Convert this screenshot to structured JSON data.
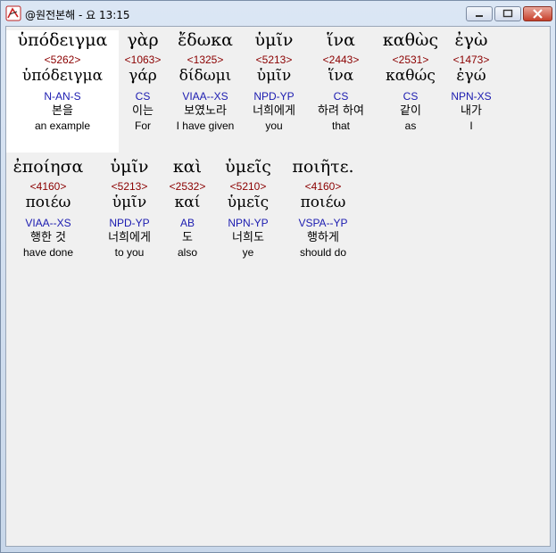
{
  "window": {
    "title": "@원전본해 - 요 13:15"
  },
  "lines": [
    {
      "words": [
        {
          "greek": "ὑπόδειγμα",
          "strong": "<5262>",
          "lemma": "ὑπόδειγμα",
          "morph": "N-AN-S",
          "korean": "본을",
          "english": "an example",
          "selected": true
        },
        {
          "greek": "γὰρ",
          "strong": "<1063>",
          "lemma": "γάρ",
          "morph": "CS",
          "korean": "이는",
          "english": "For"
        },
        {
          "greek": "ἔδωκα",
          "strong": "<1325>",
          "lemma": "δίδωμι",
          "morph": "VIAA--XS",
          "korean": "보였노라",
          "english": "I have given"
        },
        {
          "greek": "ὑμῖν",
          "strong": "<5213>",
          "lemma": "ὑμῖν",
          "morph": "NPD-YP",
          "korean": "너희에게",
          "english": "you"
        },
        {
          "greek": "ἵνα",
          "strong": "<2443>",
          "lemma": "ἵνα",
          "morph": "CS",
          "korean": "하려 하여",
          "english": "that"
        },
        {
          "greek": "καθὼς",
          "strong": "<2531>",
          "lemma": "καθώς",
          "morph": "CS",
          "korean": "같이",
          "english": "as"
        },
        {
          "greek": "ἐγὼ",
          "strong": "<1473>",
          "lemma": "ἐγώ",
          "morph": "NPN-XS",
          "korean": "내가",
          "english": "I"
        }
      ]
    },
    {
      "words": [
        {
          "greek": "ἐποίησα",
          "strong": "<4160>",
          "lemma": "ποιέω",
          "morph": "VIAA--XS",
          "korean": "행한 것",
          "english": "have done"
        },
        {
          "greek": "ὑμῖν",
          "strong": "<5213>",
          "lemma": "ὑμῖν",
          "morph": "NPD-YP",
          "korean": "너희에게",
          "english": "to you"
        },
        {
          "greek": "καὶ",
          "strong": "<2532>",
          "lemma": "καί",
          "morph": "AB",
          "korean": "도",
          "english": "also"
        },
        {
          "greek": "ὑμεῖς",
          "strong": "<5210>",
          "lemma": "ὑμεῖς",
          "morph": "NPN-YP",
          "korean": "너희도",
          "english": "ye"
        },
        {
          "greek": "ποιῆτε.",
          "strong": "<4160>",
          "lemma": "ποιέω",
          "morph": "VSPA--YP",
          "korean": "행하게",
          "english": "should do"
        }
      ]
    }
  ]
}
